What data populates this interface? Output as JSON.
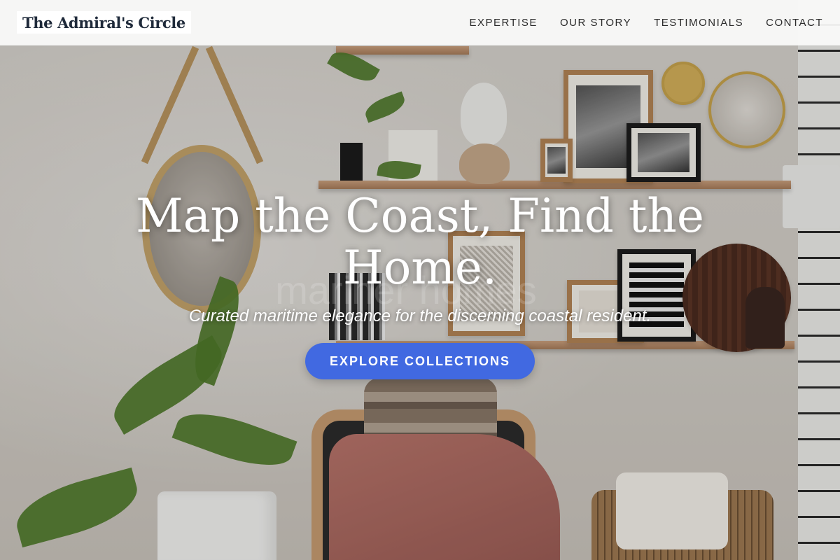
{
  "header": {
    "brand": "The Admiral's Circle",
    "nav": [
      {
        "label": "EXPERTISE"
      },
      {
        "label": "OUR STORY"
      },
      {
        "label": "TESTIMONIALS"
      },
      {
        "label": "CONTACT"
      }
    ]
  },
  "hero": {
    "title": "Map the Coast, Find the Home.",
    "subtitle": "Curated maritime elegance for the discerning coastal resident.",
    "cta_label": "EXPLORE COLLECTIONS",
    "ghost_text": "mariner homes",
    "background_description_icon": "interior-shelves-image"
  },
  "colors": {
    "accent": "#4169e1",
    "brand_text": "#1f2a3a",
    "nav_text": "#2b2b2b",
    "hero_text": "#ffffff"
  }
}
